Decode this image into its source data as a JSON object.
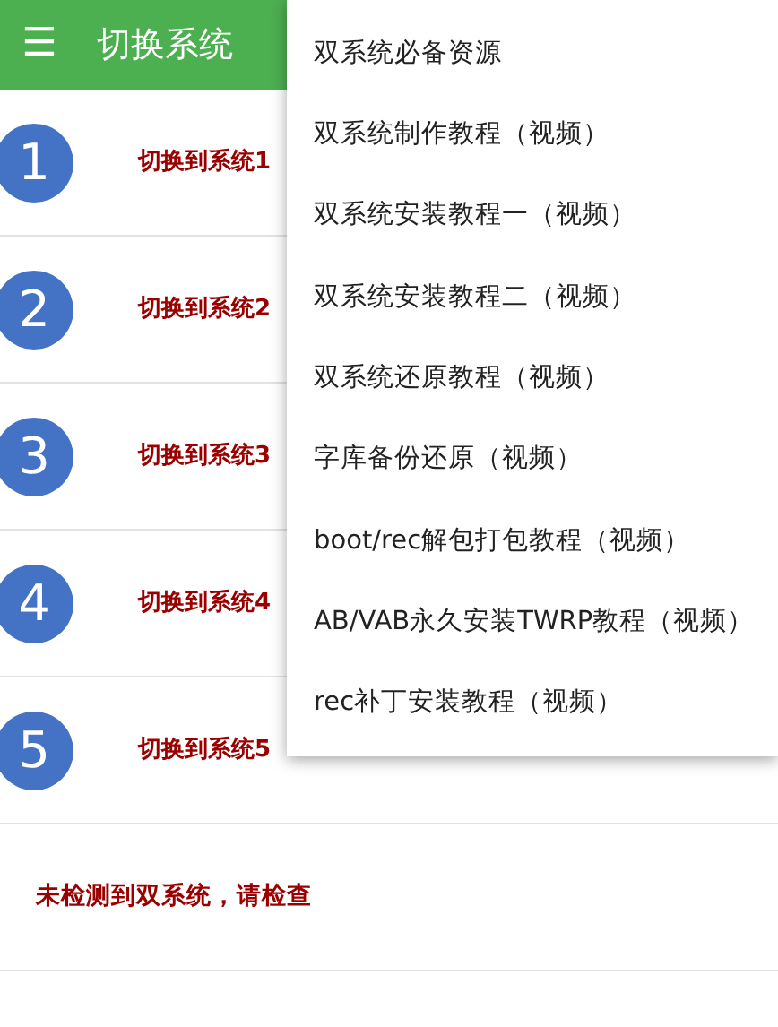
{
  "app_bar": {
    "menu_glyph": "☰",
    "title": "切换系统"
  },
  "systems": [
    {
      "number": "1",
      "label": "切换到系统1"
    },
    {
      "number": "2",
      "label": "切换到系统2"
    },
    {
      "number": "3",
      "label": "切换到系统3"
    },
    {
      "number": "4",
      "label": "切换到系统4"
    },
    {
      "number": "5",
      "label": "切换到系统5"
    }
  ],
  "message": "未检测到双系统，请检查",
  "dropdown_menu": [
    "双系统必备资源",
    "双系统制作教程（视频）",
    "双系统安装教程一（视频）",
    "双系统安装教程二（视频）",
    "双系统还原教程（视频）",
    "字库备份还原（视频）",
    "boot/rec解包打包教程（视频）",
    "AB/VAB永久安装TWRP教程（视频）",
    "rec补丁安装教程（视频）"
  ]
}
